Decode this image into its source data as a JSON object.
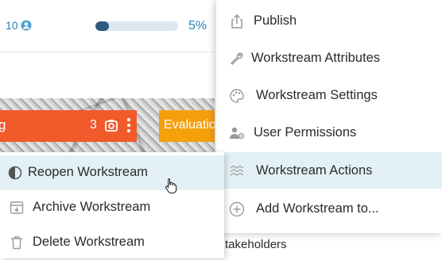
{
  "header_row": {
    "count": "10",
    "user_icon": "user-circle-icon",
    "progress_fraction": 0.05,
    "progress_label": "5%"
  },
  "cards": [
    {
      "partial_label": "g",
      "count": "3",
      "color": "#f15a2b"
    },
    {
      "label": "Evaluatio",
      "color": "#f59f0d"
    }
  ],
  "background_text": {
    "stakeholders": "takeholders"
  },
  "menu": {
    "items": [
      {
        "label": "Publish",
        "icon": "upload-icon"
      },
      {
        "label": "Workstream Attributes",
        "icon": "wrench-icon"
      },
      {
        "label": "Workstream Settings",
        "icon": "palette-icon"
      },
      {
        "label": "User Permissions",
        "icon": "user-gear-icon"
      },
      {
        "label": "Workstream Actions",
        "icon": "layers-icon",
        "active": true
      },
      {
        "label": "Add Workstream to...",
        "icon": "plus-circle-icon"
      }
    ]
  },
  "submenu": {
    "items": [
      {
        "label": "Reopen Workstream",
        "icon": "half-circle-icon",
        "active": true
      },
      {
        "label": "Archive Workstream",
        "icon": "archive-icon"
      },
      {
        "label": "Delete Workstream",
        "icon": "trash-icon"
      }
    ]
  },
  "colors": {
    "accent_text": "#2d7fb8",
    "progress_fill": "#2e5a82",
    "progress_track": "#dde6f1",
    "hover_row": "#e3f1f6"
  }
}
